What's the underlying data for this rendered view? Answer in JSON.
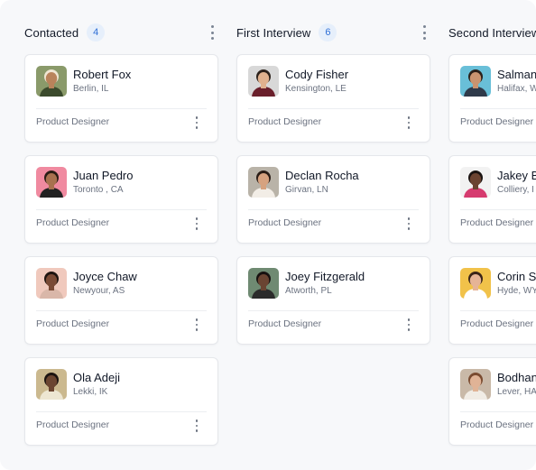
{
  "columns": [
    {
      "title": "Contacted",
      "count": "4",
      "cards": [
        {
          "name": "Robert Fox",
          "location": "Berlin, IL",
          "role": "Product Designer",
          "avatar": {
            "bg": "#8a9a6a",
            "skin": "#b9835b",
            "hair": "#efe6d3",
            "shirt": "#3b4a2c"
          }
        },
        {
          "name": "Juan Pedro",
          "location": "Toronto , CA",
          "role": "Product Designer",
          "avatar": {
            "bg": "#f08aa0",
            "skin": "#a8714f",
            "hair": "#2a1d15",
            "shirt": "#222222"
          }
        },
        {
          "name": "Joyce Chaw",
          "location": "Newyour, AS",
          "role": "Product Designer",
          "avatar": {
            "bg": "#f0c9bd",
            "skin": "#7a4a35",
            "hair": "#1e1410",
            "shirt": "#d9b7a9"
          }
        },
        {
          "name": "Ola Adeji",
          "location": "Lekki, IK",
          "role": "Product Designer",
          "avatar": {
            "bg": "#cbb98f",
            "skin": "#6b4530",
            "hair": "#1c1410",
            "shirt": "#ede6d2"
          }
        }
      ]
    },
    {
      "title": "First Interview",
      "count": "6",
      "cards": [
        {
          "name": "Cody Fisher",
          "location": "Kensington, LE",
          "role": "Product Designer",
          "avatar": {
            "bg": "#d8d8d8",
            "skin": "#e0b18e",
            "hair": "#2c211b",
            "shirt": "#6a1f2b"
          }
        },
        {
          "name": "Declan Rocha",
          "location": "Girvan, LN",
          "role": "Product Designer",
          "avatar": {
            "bg": "#b9b3a8",
            "skin": "#d6a27f",
            "hair": "#2a1d16",
            "shirt": "#f2ede6"
          }
        },
        {
          "name": "Joey Fitzgerald",
          "location": "Atworth, PL",
          "role": "Product Designer",
          "avatar": {
            "bg": "#6f8a72",
            "skin": "#6a4432",
            "hair": "#171110",
            "shirt": "#2b2b2b"
          }
        }
      ]
    },
    {
      "title": "Second Interview",
      "count": "",
      "cards": [
        {
          "name": "Salman",
          "location": "Halifax, W",
          "role": "Product Designer",
          "avatar": {
            "bg": "#69bfd8",
            "skin": "#c99470",
            "hair": "#2b211b",
            "shirt": "#2f3a4a"
          }
        },
        {
          "name": "Jakey B",
          "location": "Colliery, I",
          "role": "Product Designer",
          "avatar": {
            "bg": "#f2f2f2",
            "skin": "#6b4331",
            "hair": "#1b1412",
            "shirt": "#d63b6f"
          }
        },
        {
          "name": "Corin Sr",
          "location": "Hyde, WY",
          "role": "Product Designer",
          "avatar": {
            "bg": "#f1c24a",
            "skin": "#e6b496",
            "hair": "#3a2418",
            "shirt": "#ffffff"
          }
        },
        {
          "name": "Bodhan",
          "location": "Lever, HA",
          "role": "Product Designer",
          "avatar": {
            "bg": "#c9b9a8",
            "skin": "#e0b396",
            "hair": "#7a4b30",
            "shirt": "#f1ece5"
          }
        }
      ]
    }
  ]
}
